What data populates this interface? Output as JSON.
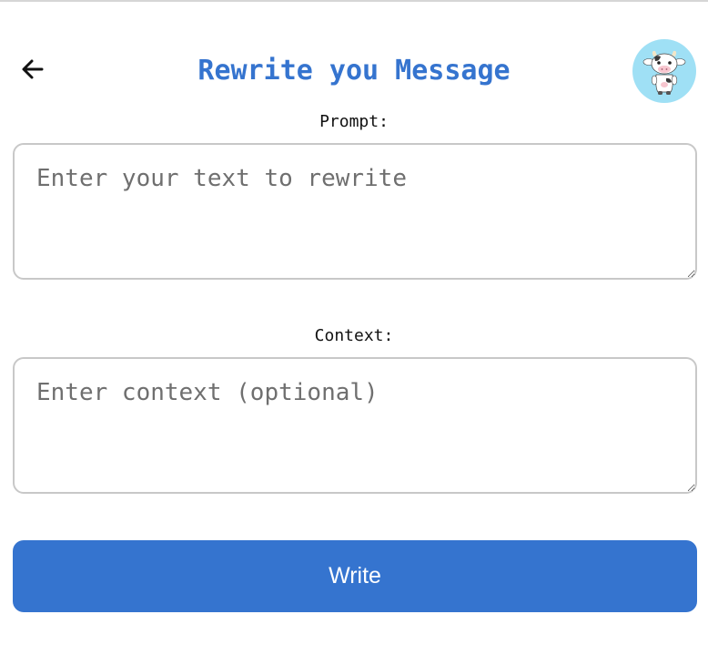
{
  "header": {
    "title": "Rewrite you Message",
    "back_icon": "arrow-left-icon",
    "avatar_icon": "cow-mascot-icon"
  },
  "form": {
    "prompt": {
      "label": "Prompt:",
      "placeholder": "Enter your text to rewrite",
      "value": ""
    },
    "context": {
      "label": "Context:",
      "placeholder": "Enter context (optional)",
      "value": ""
    },
    "submit_label": "Write"
  },
  "colors": {
    "accent": "#3574cf",
    "avatar_bg": "#9fe0f5",
    "field_border": "#c8c8c8",
    "placeholder": "#6f6f6f"
  }
}
